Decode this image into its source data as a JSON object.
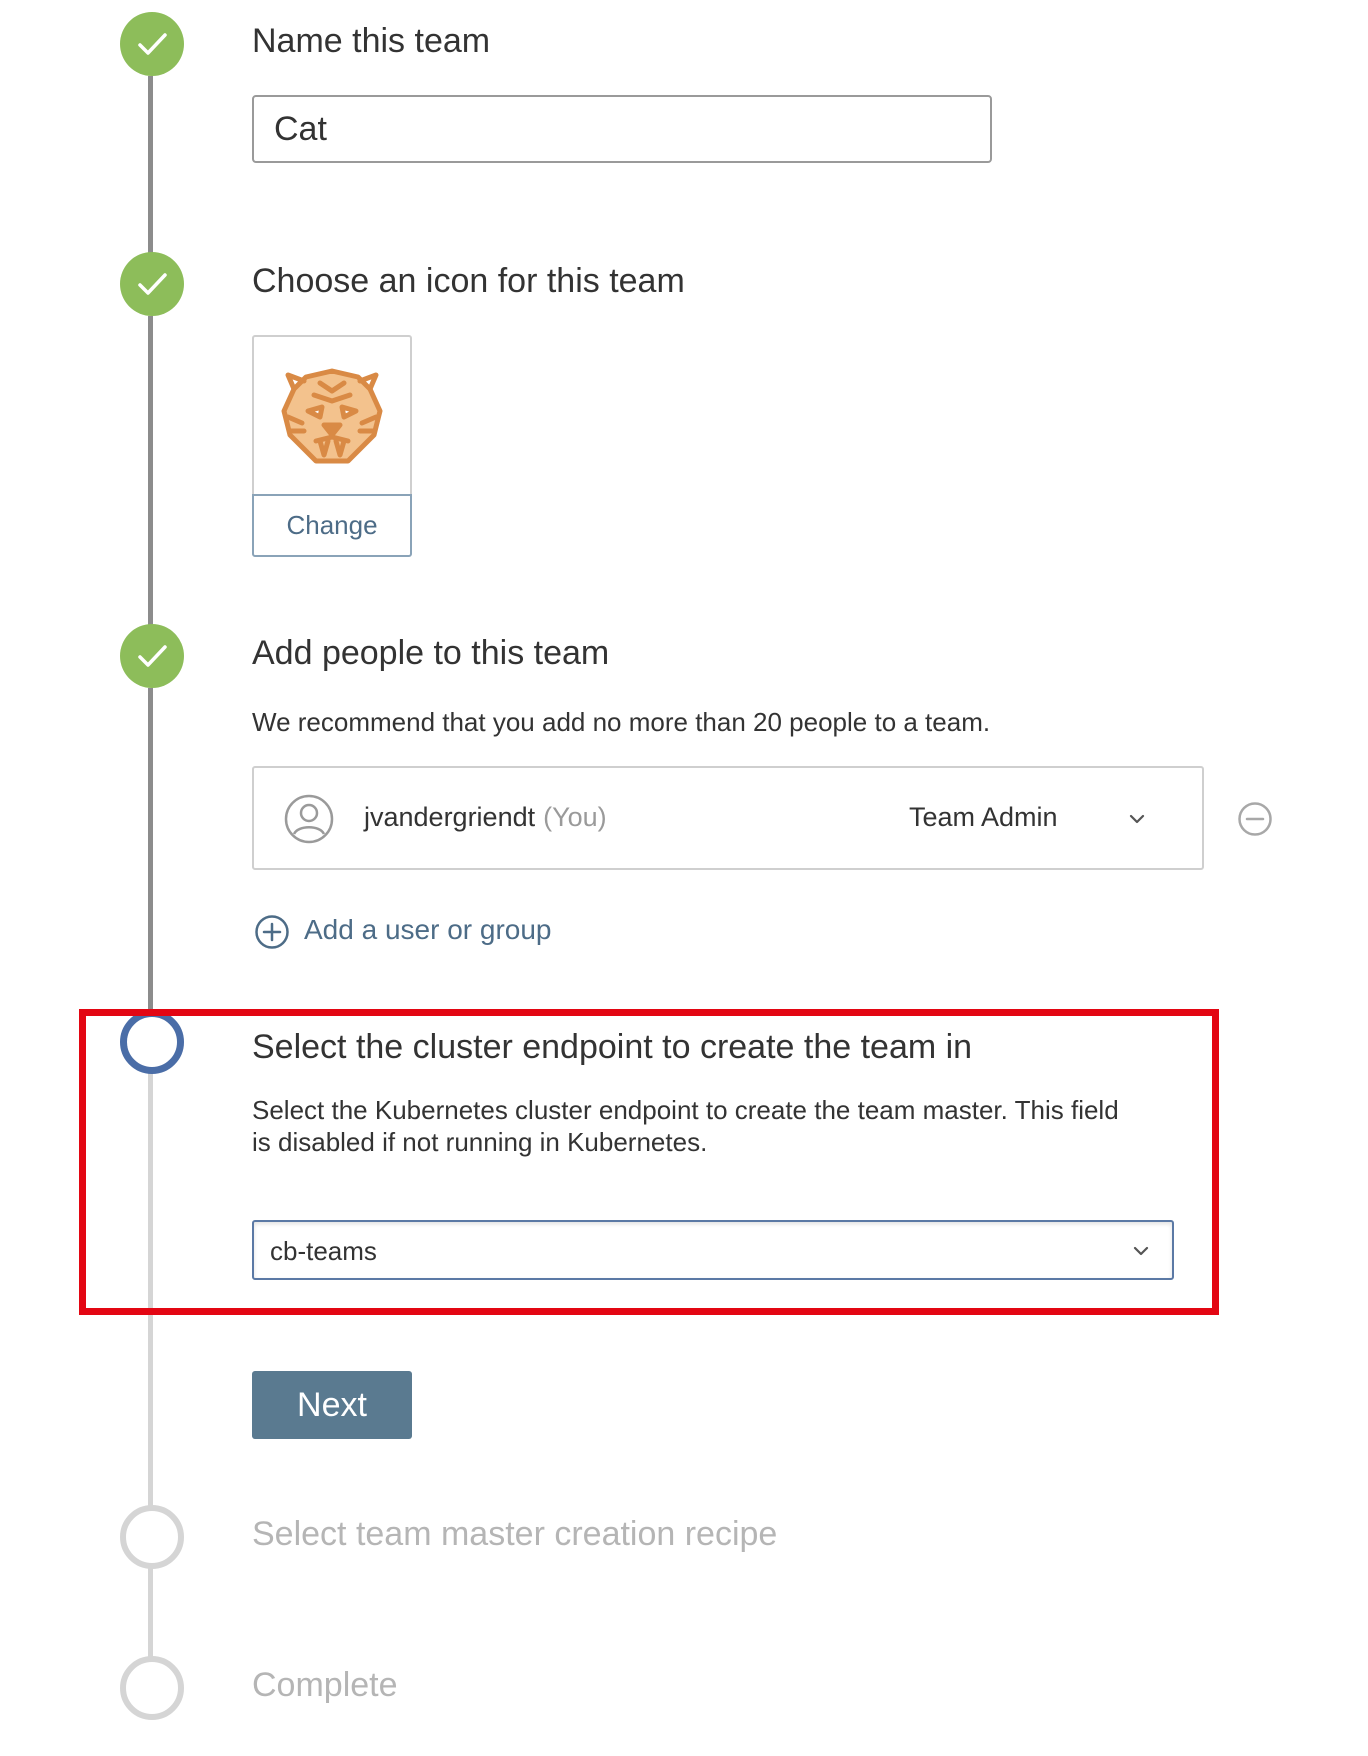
{
  "colors": {
    "step_done": "#8dbd5a",
    "step_current": "#4a6da7",
    "step_pending": "#d5d5d5",
    "link": "#4d6c87",
    "primary_button": "#5a7a90",
    "highlight_box": "#e30613"
  },
  "steps": [
    {
      "title": "Name this team",
      "state": "done",
      "icon": "check-icon"
    },
    {
      "title": "Choose an icon for this team",
      "state": "done",
      "icon": "check-icon"
    },
    {
      "title": "Add people to this team",
      "state": "done",
      "icon": "check-icon"
    },
    {
      "title": "Select the cluster endpoint to create the team in",
      "state": "current"
    },
    {
      "title": "Select team master creation recipe",
      "state": "pending"
    },
    {
      "title": "Complete",
      "state": "pending"
    }
  ],
  "name_step": {
    "value": "Cat"
  },
  "icon_step": {
    "icon": "tiger-icon",
    "change_label": "Change"
  },
  "people_step": {
    "help": "We recommend that you add no more than 20 people to a team.",
    "members": [
      {
        "username": "jvandergriendt",
        "you_label": "(You)",
        "role": "Team Admin",
        "avatar": "user-icon"
      }
    ],
    "add_label": "Add a user or group"
  },
  "cluster_step": {
    "help": "Select the Kubernetes cluster endpoint to create the team master. This field is disabled if not running in Kubernetes.",
    "selected": "cb-teams"
  },
  "next_label": "Next"
}
